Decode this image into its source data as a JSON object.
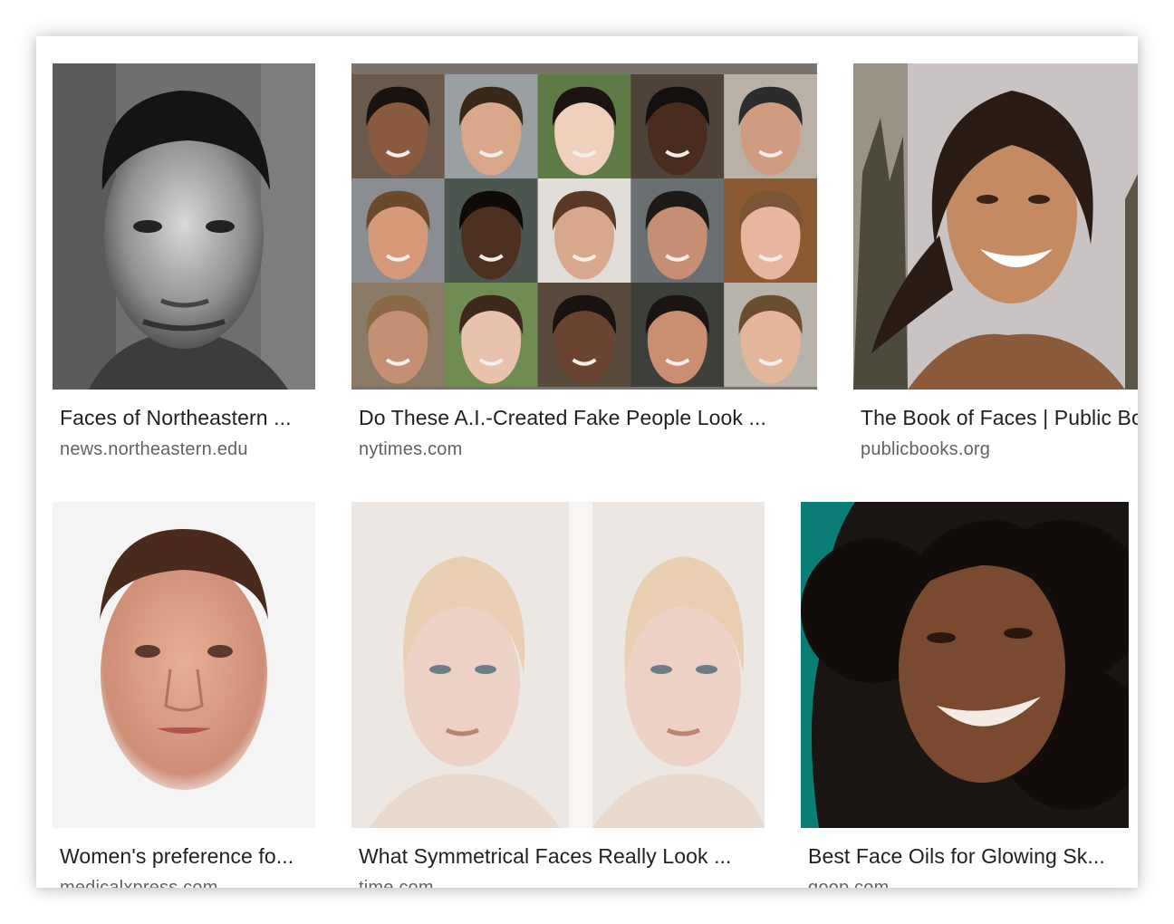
{
  "results": [
    {
      "title": "Faces of Northeastern ...",
      "source": "news.northeastern.edu"
    },
    {
      "title": "Do These A.I.-Created Fake People Look ...",
      "source": "nytimes.com"
    },
    {
      "title": "The Book of Faces | Public Books",
      "source": "publicbooks.org"
    },
    {
      "title": "Women's preference fo...",
      "source": "medicalxpress.com"
    },
    {
      "title": "What Symmetrical Faces Really Look ...",
      "source": "time.com"
    },
    {
      "title": "Best Face Oils for Glowing Sk...",
      "source": "goop.com"
    }
  ],
  "colors": {
    "title": "#202124",
    "source": "#5f6368",
    "frame": "#7a726c"
  }
}
